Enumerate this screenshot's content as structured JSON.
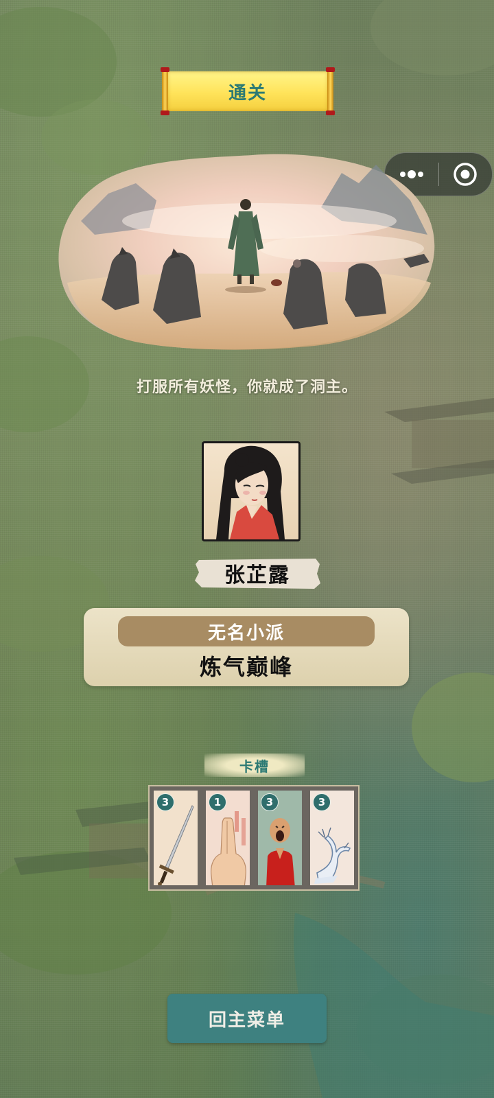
{
  "header": {
    "title": "通关"
  },
  "capsule": {
    "more_icon": "more-dots-icon",
    "close_icon": "target-circle-icon"
  },
  "scene": {
    "caption": "打服所有妖怪，你就成了洞主。"
  },
  "player": {
    "name": "张芷露",
    "sect": "无名小派",
    "realm": "炼气巅峰"
  },
  "card_slots": {
    "title": "卡槽",
    "cards": [
      {
        "count": "3",
        "icon": "sword-icon"
      },
      {
        "count": "1",
        "icon": "hand-seal-icon"
      },
      {
        "count": "3",
        "icon": "shouting-monk-icon"
      },
      {
        "count": "3",
        "icon": "frozen-tree-icon"
      }
    ]
  },
  "actions": {
    "main_menu": "回主菜单"
  },
  "colors": {
    "accent_teal": "#3e8180",
    "scroll_yellow": "#ffe35a",
    "sect_bar": "#a88c63"
  }
}
